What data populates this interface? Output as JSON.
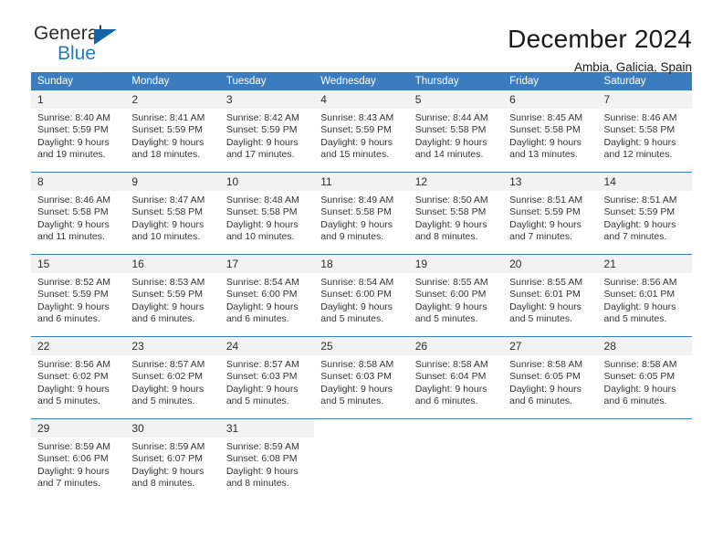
{
  "brand": {
    "name_part1": "General",
    "name_part2": "Blue",
    "triangle_color": "#1464a5",
    "accent_color": "#1f7ac2"
  },
  "header": {
    "title": "December 2024",
    "subtitle": "Ambia, Galicia, Spain"
  },
  "calendar": {
    "header_bg": "#3b7cbf",
    "daynum_bg": "#f2f2f2",
    "weekdays": [
      "Sunday",
      "Monday",
      "Tuesday",
      "Wednesday",
      "Thursday",
      "Friday",
      "Saturday"
    ],
    "weeks": [
      [
        {
          "day": "1",
          "sunrise": "Sunrise: 8:40 AM",
          "sunset": "Sunset: 5:59 PM",
          "daylight": "Daylight: 9 hours and 19 minutes."
        },
        {
          "day": "2",
          "sunrise": "Sunrise: 8:41 AM",
          "sunset": "Sunset: 5:59 PM",
          "daylight": "Daylight: 9 hours and 18 minutes."
        },
        {
          "day": "3",
          "sunrise": "Sunrise: 8:42 AM",
          "sunset": "Sunset: 5:59 PM",
          "daylight": "Daylight: 9 hours and 17 minutes."
        },
        {
          "day": "4",
          "sunrise": "Sunrise: 8:43 AM",
          "sunset": "Sunset: 5:59 PM",
          "daylight": "Daylight: 9 hours and 15 minutes."
        },
        {
          "day": "5",
          "sunrise": "Sunrise: 8:44 AM",
          "sunset": "Sunset: 5:58 PM",
          "daylight": "Daylight: 9 hours and 14 minutes."
        },
        {
          "day": "6",
          "sunrise": "Sunrise: 8:45 AM",
          "sunset": "Sunset: 5:58 PM",
          "daylight": "Daylight: 9 hours and 13 minutes."
        },
        {
          "day": "7",
          "sunrise": "Sunrise: 8:46 AM",
          "sunset": "Sunset: 5:58 PM",
          "daylight": "Daylight: 9 hours and 12 minutes."
        }
      ],
      [
        {
          "day": "8",
          "sunrise": "Sunrise: 8:46 AM",
          "sunset": "Sunset: 5:58 PM",
          "daylight": "Daylight: 9 hours and 11 minutes."
        },
        {
          "day": "9",
          "sunrise": "Sunrise: 8:47 AM",
          "sunset": "Sunset: 5:58 PM",
          "daylight": "Daylight: 9 hours and 10 minutes."
        },
        {
          "day": "10",
          "sunrise": "Sunrise: 8:48 AM",
          "sunset": "Sunset: 5:58 PM",
          "daylight": "Daylight: 9 hours and 10 minutes."
        },
        {
          "day": "11",
          "sunrise": "Sunrise: 8:49 AM",
          "sunset": "Sunset: 5:58 PM",
          "daylight": "Daylight: 9 hours and 9 minutes."
        },
        {
          "day": "12",
          "sunrise": "Sunrise: 8:50 AM",
          "sunset": "Sunset: 5:58 PM",
          "daylight": "Daylight: 9 hours and 8 minutes."
        },
        {
          "day": "13",
          "sunrise": "Sunrise: 8:51 AM",
          "sunset": "Sunset: 5:59 PM",
          "daylight": "Daylight: 9 hours and 7 minutes."
        },
        {
          "day": "14",
          "sunrise": "Sunrise: 8:51 AM",
          "sunset": "Sunset: 5:59 PM",
          "daylight": "Daylight: 9 hours and 7 minutes."
        }
      ],
      [
        {
          "day": "15",
          "sunrise": "Sunrise: 8:52 AM",
          "sunset": "Sunset: 5:59 PM",
          "daylight": "Daylight: 9 hours and 6 minutes."
        },
        {
          "day": "16",
          "sunrise": "Sunrise: 8:53 AM",
          "sunset": "Sunset: 5:59 PM",
          "daylight": "Daylight: 9 hours and 6 minutes."
        },
        {
          "day": "17",
          "sunrise": "Sunrise: 8:54 AM",
          "sunset": "Sunset: 6:00 PM",
          "daylight": "Daylight: 9 hours and 6 minutes."
        },
        {
          "day": "18",
          "sunrise": "Sunrise: 8:54 AM",
          "sunset": "Sunset: 6:00 PM",
          "daylight": "Daylight: 9 hours and 5 minutes."
        },
        {
          "day": "19",
          "sunrise": "Sunrise: 8:55 AM",
          "sunset": "Sunset: 6:00 PM",
          "daylight": "Daylight: 9 hours and 5 minutes."
        },
        {
          "day": "20",
          "sunrise": "Sunrise: 8:55 AM",
          "sunset": "Sunset: 6:01 PM",
          "daylight": "Daylight: 9 hours and 5 minutes."
        },
        {
          "day": "21",
          "sunrise": "Sunrise: 8:56 AM",
          "sunset": "Sunset: 6:01 PM",
          "daylight": "Daylight: 9 hours and 5 minutes."
        }
      ],
      [
        {
          "day": "22",
          "sunrise": "Sunrise: 8:56 AM",
          "sunset": "Sunset: 6:02 PM",
          "daylight": "Daylight: 9 hours and 5 minutes."
        },
        {
          "day": "23",
          "sunrise": "Sunrise: 8:57 AM",
          "sunset": "Sunset: 6:02 PM",
          "daylight": "Daylight: 9 hours and 5 minutes."
        },
        {
          "day": "24",
          "sunrise": "Sunrise: 8:57 AM",
          "sunset": "Sunset: 6:03 PM",
          "daylight": "Daylight: 9 hours and 5 minutes."
        },
        {
          "day": "25",
          "sunrise": "Sunrise: 8:58 AM",
          "sunset": "Sunset: 6:03 PM",
          "daylight": "Daylight: 9 hours and 5 minutes."
        },
        {
          "day": "26",
          "sunrise": "Sunrise: 8:58 AM",
          "sunset": "Sunset: 6:04 PM",
          "daylight": "Daylight: 9 hours and 6 minutes."
        },
        {
          "day": "27",
          "sunrise": "Sunrise: 8:58 AM",
          "sunset": "Sunset: 6:05 PM",
          "daylight": "Daylight: 9 hours and 6 minutes."
        },
        {
          "day": "28",
          "sunrise": "Sunrise: 8:58 AM",
          "sunset": "Sunset: 6:05 PM",
          "daylight": "Daylight: 9 hours and 6 minutes."
        }
      ],
      [
        {
          "day": "29",
          "sunrise": "Sunrise: 8:59 AM",
          "sunset": "Sunset: 6:06 PM",
          "daylight": "Daylight: 9 hours and 7 minutes."
        },
        {
          "day": "30",
          "sunrise": "Sunrise: 8:59 AM",
          "sunset": "Sunset: 6:07 PM",
          "daylight": "Daylight: 9 hours and 8 minutes."
        },
        {
          "day": "31",
          "sunrise": "Sunrise: 8:59 AM",
          "sunset": "Sunset: 6:08 PM",
          "daylight": "Daylight: 9 hours and 8 minutes."
        },
        {
          "day": "",
          "sunrise": "",
          "sunset": "",
          "daylight": ""
        },
        {
          "day": "",
          "sunrise": "",
          "sunset": "",
          "daylight": ""
        },
        {
          "day": "",
          "sunrise": "",
          "sunset": "",
          "daylight": ""
        },
        {
          "day": "",
          "sunrise": "",
          "sunset": "",
          "daylight": ""
        }
      ]
    ]
  }
}
